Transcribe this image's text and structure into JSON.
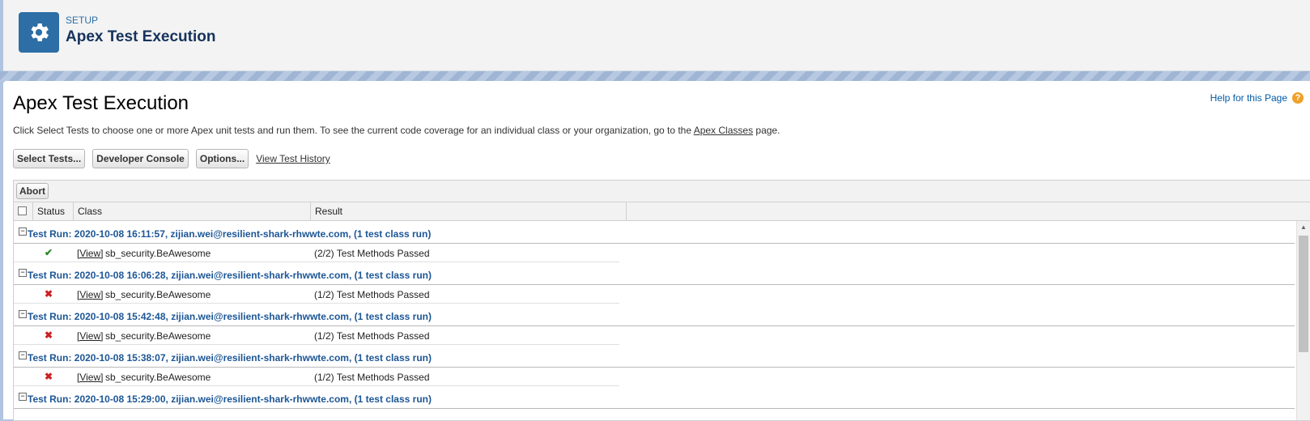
{
  "header": {
    "section_label": "SETUP",
    "title": "Apex Test Execution"
  },
  "page": {
    "title": "Apex Test Execution",
    "help_link": "Help for this Page",
    "description_before": "Click Select Tests to choose one or more Apex unit tests and run them. To see the current code coverage for an individual class or your organization, go to the ",
    "description_link": "Apex Classes",
    "description_after": " page."
  },
  "toolbar": {
    "select_tests": "Select Tests...",
    "developer_console": "Developer Console",
    "options": "Options...",
    "view_history": "View Test History"
  },
  "grid": {
    "abort_label": "Abort",
    "columns": {
      "status": "Status",
      "class": "Class",
      "result": "Result"
    },
    "runs": [
      {
        "label": "Test Run: 2020-10-08 16:11:57, zijian.wei@resilient-shark-rhwwte.com, (1 test class run)",
        "status": "pass",
        "view": "[View]",
        "class": "sb_security.BeAwesome",
        "result": "(2/2) Test Methods Passed"
      },
      {
        "label": "Test Run: 2020-10-08 16:06:28, zijian.wei@resilient-shark-rhwwte.com, (1 test class run)",
        "status": "fail",
        "view": "[View]",
        "class": "sb_security.BeAwesome",
        "result": "(1/2) Test Methods Passed"
      },
      {
        "label": "Test Run: 2020-10-08 15:42:48, zijian.wei@resilient-shark-rhwwte.com, (1 test class run)",
        "status": "fail",
        "view": "[View]",
        "class": "sb_security.BeAwesome",
        "result": "(1/2) Test Methods Passed"
      },
      {
        "label": "Test Run: 2020-10-08 15:38:07, zijian.wei@resilient-shark-rhwwte.com, (1 test class run)",
        "status": "fail",
        "view": "[View]",
        "class": "sb_security.BeAwesome",
        "result": "(1/2) Test Methods Passed"
      },
      {
        "label": "Test Run: 2020-10-08 15:29:00, zijian.wei@resilient-shark-rhwwte.com, (1 test class run)"
      }
    ]
  },
  "colors": {
    "brand_blue": "#2c6ea5",
    "link_blue": "#1c5696",
    "pass": "#2b8a28",
    "fail": "#cc1f1f"
  }
}
